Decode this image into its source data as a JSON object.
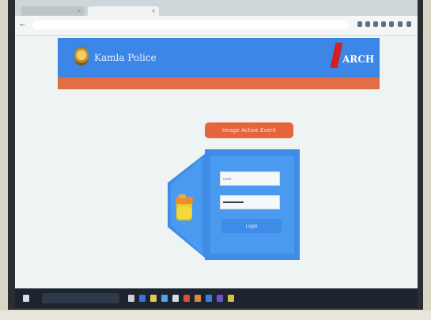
{
  "colors": {
    "banner": "#3b86e6",
    "stripe": "#e36e45",
    "brand_accent": "#d51f1f",
    "panel": "#3f8be8"
  },
  "browser": {
    "tabs": [
      {
        "label": ""
      },
      {
        "label": ""
      }
    ],
    "address": {
      "url": ""
    }
  },
  "header": {
    "site_title": "Kamla Police",
    "brand": "ARCH",
    "logo_icon": "police-emblem-icon"
  },
  "login": {
    "heading": "Image Active Event",
    "folder_icon": "folder-icon",
    "username_placeholder": "user",
    "password_value": "",
    "button_label": "Login"
  },
  "taskbar": {
    "search_placeholder": "",
    "tray": ""
  }
}
